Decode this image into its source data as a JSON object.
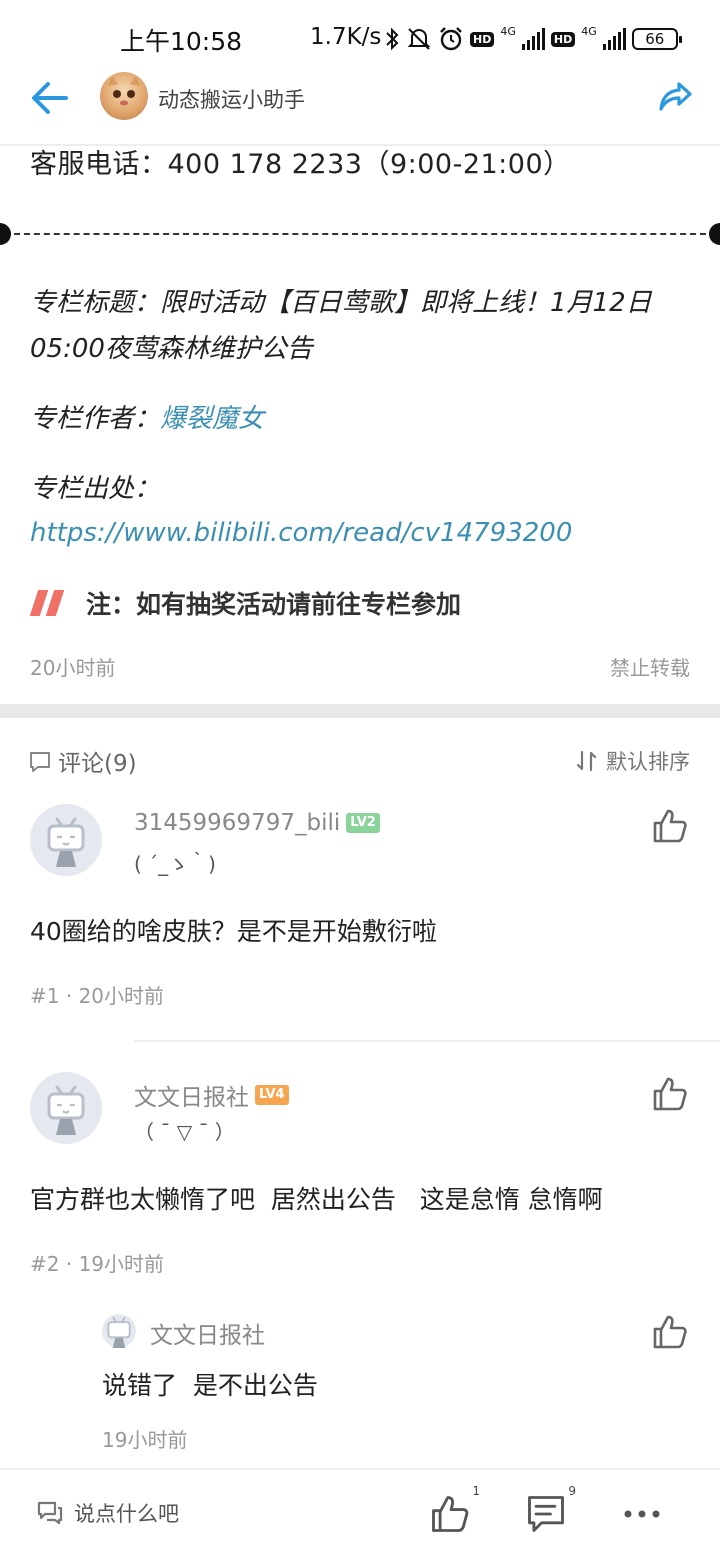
{
  "status_bar": {
    "time": "上午10:58",
    "net_speed": "1.7K/s",
    "hd_label": "HD",
    "net_type": "4G",
    "battery": "66"
  },
  "header": {
    "title": "动态搬运小助手"
  },
  "post": {
    "service_line": "客服电话：400 178 2233（9:00-21:00）",
    "column_title": "专栏标题：限时活动【百日莺歌】即将上线！1月12日05:00夜莺森林维护公告",
    "author_label": "专栏作者：",
    "author_name": "爆裂魔女",
    "source_label": "专栏出处：",
    "source_url": "https://www.bilibili.com/read/cv14793200",
    "note": "注：如有抽奖活动请前往专栏参加",
    "time_ago": "20小时前",
    "no_repost": "禁止转载"
  },
  "comments_section": {
    "title": "评论(9)",
    "sort_label": "默认排序"
  },
  "comments": [
    {
      "username": "31459969797_bili",
      "level": "LV2",
      "signature": "( ´_ゝ｀)",
      "text": "40圈给的啥皮肤？是不是开始敷衍啦",
      "index": "#1",
      "time": "20小时前"
    },
    {
      "username": "文文日报社",
      "level": "LV4",
      "signature": "（ ˉ ▽ ˉ ）",
      "text": "官方群也太懒惰了吧  居然出公告   这是怠惰 怠惰啊",
      "index": "#2",
      "time": "19小时前",
      "reply": {
        "username": "文文日报社",
        "text": "说错了  是不出公告",
        "time": "19小时前"
      }
    }
  ],
  "bottom_bar": {
    "input_hint": "说点什么吧",
    "like_count": "1",
    "comment_count": "9"
  },
  "colors": {
    "link": "#3b8fb2",
    "note_accent": "#f07067",
    "lv2": "#8bd29b",
    "lv4": "#f6a650"
  }
}
